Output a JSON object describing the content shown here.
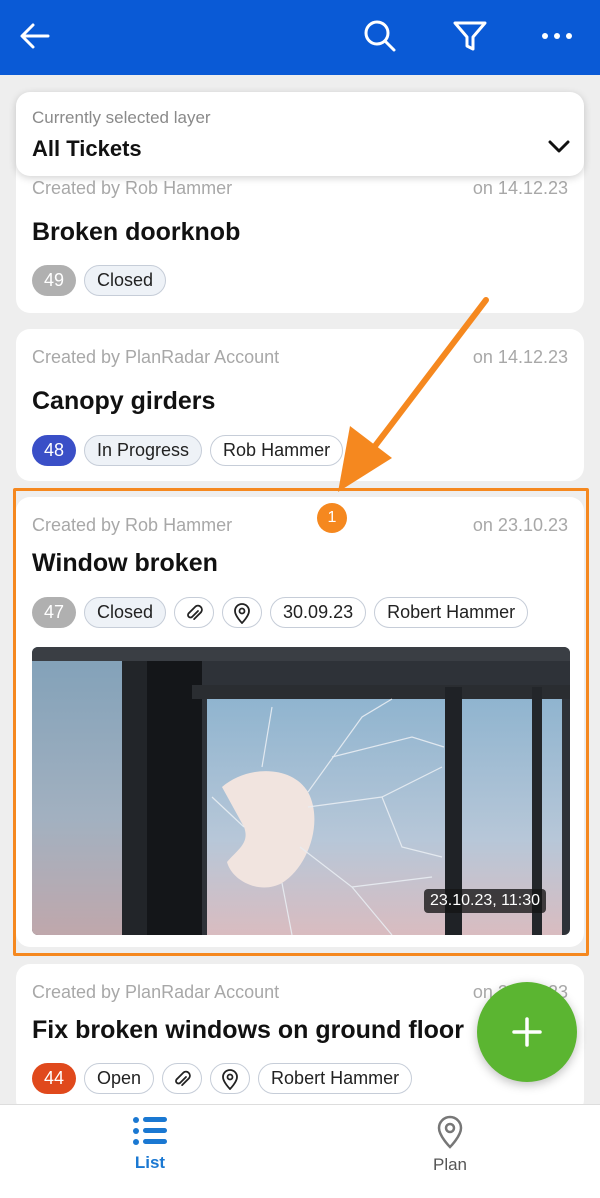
{
  "header": {
    "back_icon": "arrow-left-icon",
    "search_icon": "search-icon",
    "filter_icon": "filter-icon",
    "more_icon": "more-horizontal-icon",
    "color": "#0a5ad6"
  },
  "layer_selector": {
    "label": "Currently selected layer",
    "value": "All Tickets"
  },
  "tickets": [
    {
      "created_by": "Created by Rob Hammer",
      "date": "on 14.12.23",
      "title": "Broken doorknob",
      "number": "49",
      "number_color": "#b0b0b0",
      "status": "Closed"
    },
    {
      "created_by": "Created by PlanRadar Account",
      "date": "on 14.12.23",
      "title": "Canopy girders",
      "number": "48",
      "number_color": "#3a4fc7",
      "status": "In Progress",
      "assignee": "Rob Hammer"
    },
    {
      "created_by": "Created by Rob Hammer",
      "date": "on 23.10.23",
      "title": "Window broken",
      "number": "47",
      "number_color": "#b0b0b0",
      "status": "Closed",
      "due_date": "30.09.23",
      "assignee": "Robert Hammer",
      "photo_timestamp": "23.10.23, 11:30"
    },
    {
      "created_by": "Created by PlanRadar Account",
      "date": "on 20.12.23",
      "title": "Fix broken windows on ground floor",
      "number": "44",
      "number_color": "#e0491c",
      "status": "Open",
      "assignee": "Robert Hammer"
    }
  ],
  "annotation": {
    "marker": "1",
    "color": "#f5881f"
  },
  "fab": {
    "icon": "plus-icon",
    "color": "#5bb531"
  },
  "bottom_nav": {
    "list_label": "List",
    "plan_label": "Plan",
    "active": "List",
    "active_color": "#1a78d2"
  }
}
